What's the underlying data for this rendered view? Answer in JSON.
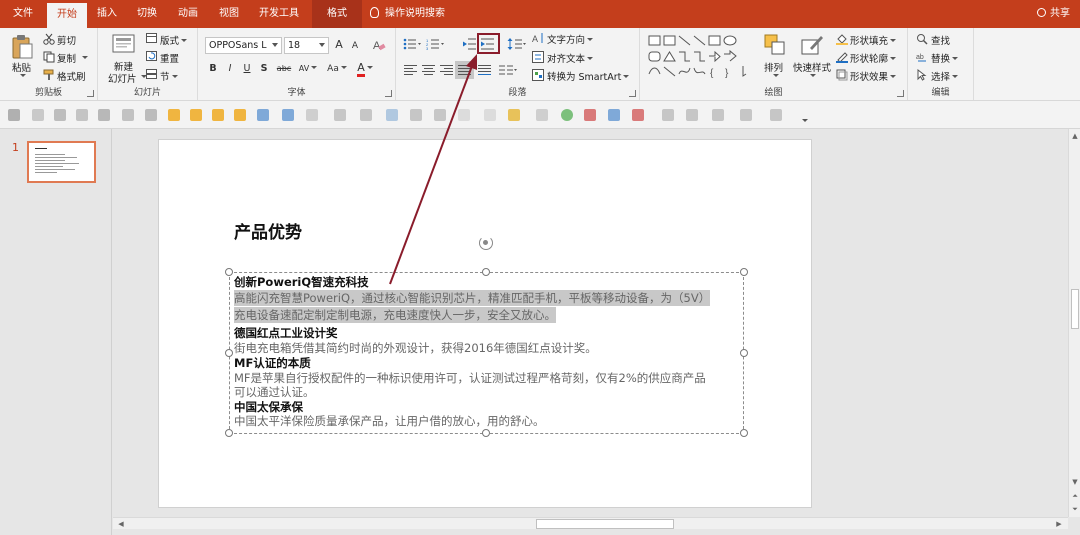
{
  "tabs": [
    {
      "label": "文件"
    },
    {
      "label": "开始"
    },
    {
      "label": "插入"
    },
    {
      "label": "切换"
    },
    {
      "label": "动画"
    },
    {
      "label": "视图"
    },
    {
      "label": "开发工具"
    },
    {
      "label": "格式"
    }
  ],
  "tell_me": "操作说明搜索",
  "share": "共享",
  "ribbon": {
    "clipboard": {
      "paste": "粘贴",
      "cut": "剪切",
      "copy": "复制",
      "format_painter": "格式刷",
      "label": "剪贴板"
    },
    "slides": {
      "new_slide_line1": "新建",
      "new_slide_line2": "幻灯片",
      "layout": "版式",
      "reset": "重置",
      "section": "节",
      "label": "幻灯片"
    },
    "font": {
      "font_name": "OPPOSans L",
      "font_size": "18",
      "grow": "A",
      "shrink": "A",
      "bold": "B",
      "italic": "I",
      "underline": "U",
      "shadow": "S",
      "strike": "abc",
      "spacing": "AV",
      "case": "Aa",
      "color": "A",
      "label": "字体"
    },
    "paragraph": {
      "text_direction": "文字方向",
      "align_text": "对齐文本",
      "smartart": "转换为 SmartArt",
      "label": "段落"
    },
    "drawing": {
      "arrange": "排列",
      "quick_styles": "快速样式",
      "shape_fill": "形状填充",
      "shape_outline": "形状轮廓",
      "shape_effects": "形状效果",
      "label": "绘图"
    },
    "editing": {
      "find": "查找",
      "replace": "替换",
      "select": "选择",
      "label": "编辑"
    }
  },
  "thumbnail": {
    "slide_number": "1"
  },
  "slide": {
    "title": "产品优势",
    "items": [
      {
        "heading": "创新PoweriQ智速充科技",
        "body_lines": [
          "高能闪充智慧PoweriQ，通过核心智能识别芯片，精准匹配手机，平板等移动设备，为（5V）",
          "充电设备速配定制定制电源，充电速度快人一步，安全又放心。"
        ]
      },
      {
        "heading": "德国红点工业设计奖",
        "body_lines": [
          "街电充电箱凭借其简约时尚的外观设计，获得2016年德国红点设计奖。"
        ]
      },
      {
        "heading": "MF认证的本质",
        "body_lines": [
          "MF是苹果自行授权配件的一种标识使用许可，认证测试过程严格苛刻，仅有2%的供应商产品",
          "可以通过认证。"
        ]
      },
      {
        "heading": "中国太保承保",
        "body_lines": [
          "中国太平洋保险质量承保产品，让用户借的放心，用的舒心。"
        ]
      }
    ]
  },
  "colors": {
    "accent": "#c43e1c",
    "annotation": "#8a1c2b",
    "selection": "#c8c8c8"
  }
}
